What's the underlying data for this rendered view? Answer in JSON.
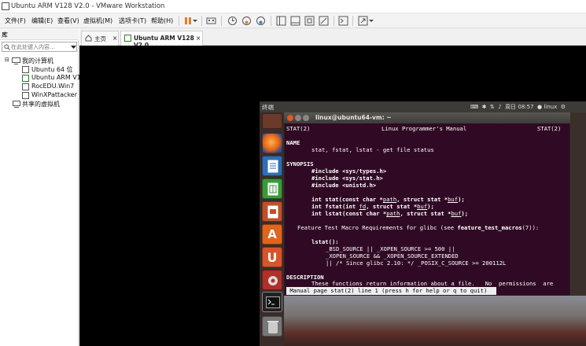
{
  "window": {
    "title": "Ubuntu ARM V128 V2.0 - VMware Workstation"
  },
  "menu": [
    "文件(F)",
    "编辑(E)",
    "查看(V)",
    "虚拟机(M)",
    "选项卡(T)",
    "帮助(H)"
  ],
  "library": {
    "title": "库",
    "close": "×",
    "search_placeholder": "在此处键入内容...",
    "my_computer": "我的计算机",
    "vms": [
      "Ubuntu 64 位",
      "Ubuntu ARM V1",
      "RocEDU.Win7",
      "WinXPattacker"
    ],
    "shared": "共享的虚拟机"
  },
  "tabs": [
    {
      "label": "主页"
    },
    {
      "label": "Ubuntu ARM V128 V2.0"
    }
  ],
  "guest": {
    "panel_title": "终端",
    "panel_status": "周日 08:57",
    "panel_user": "linux",
    "terminal_title": "linux@ubuntu64-vm: ~",
    "man_header_left": "STAT(2)",
    "man_header_center": "Linux Programmer's Manual",
    "man_header_right": "STAT(2)",
    "name_heading": "NAME",
    "name_line": "stat, fstat, lstat - get file status",
    "synopsis_heading": "SYNOPSIS",
    "include1": "#include <sys/types.h>",
    "include2": "#include <sys/stat.h>",
    "include3": "#include <unistd.h>",
    "ftm": "Feature Test Macro Requirements for glibc (see",
    "ftm_fn": "feature_test_macros",
    "ftm_end": "(7)):",
    "lstat_line": "lstat():",
    "cond1": "_BSD_SOURCE || _XOPEN_SOURCE >= 500 ||",
    "cond2": "_XOPEN_SOURCE && _XOPEN_SOURCE_EXTENDED",
    "cond3": "|| /* Since glibc 2.10: */ _POSIX_C_SOURCE >= 200112L",
    "desc_heading": "DESCRIPTION",
    "desc_line": "These functions return information about a file.   No  permissions  are",
    "status": " Manual page stat(2) line 1 (press h for help or q to quit)"
  },
  "colors": {
    "terminal_bg": "#300a24",
    "ubuntu_panel": "#3c3b37",
    "vm_bg": "#000000"
  }
}
